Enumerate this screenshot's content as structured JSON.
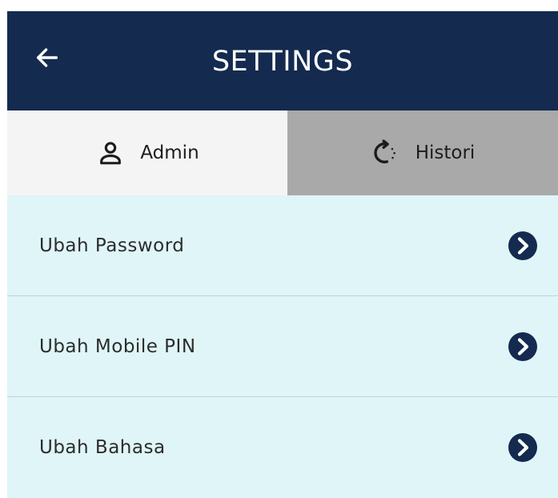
{
  "header": {
    "title": "SETTINGS",
    "back_icon": "arrow-left-icon",
    "background_color": "#142a4f"
  },
  "tabs": [
    {
      "label": "Admin",
      "icon": "user-icon",
      "selected": true
    },
    {
      "label": "Histori",
      "icon": "refresh-icon",
      "selected": false
    }
  ],
  "menu": {
    "items": [
      {
        "label": "Ubah Password",
        "icon": "chevron-right-circle-icon"
      },
      {
        "label": "Ubah Mobile PIN",
        "icon": "chevron-right-circle-icon"
      },
      {
        "label": "Ubah Bahasa",
        "icon": "chevron-right-circle-icon"
      }
    ]
  },
  "colors": {
    "accent": "#142a4f",
    "list_background": "#dff5f8",
    "tab_active": "#f4f4f4",
    "tab_inactive": "#a9a9a9"
  }
}
